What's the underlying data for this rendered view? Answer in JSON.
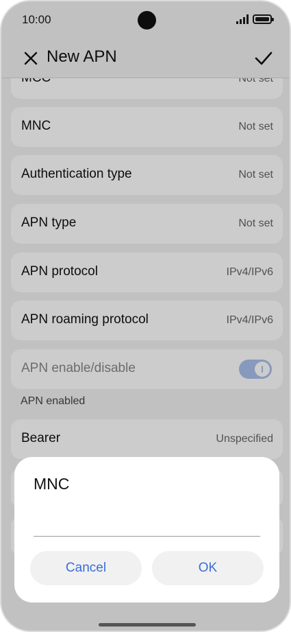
{
  "status_bar": {
    "time": "10:00"
  },
  "header": {
    "title": "New APN"
  },
  "list": {
    "rows": [
      {
        "label": "MCC",
        "value": "Not set"
      },
      {
        "label": "MNC",
        "value": "Not set"
      },
      {
        "label": "Authentication type",
        "value": "Not set"
      },
      {
        "label": "APN type",
        "value": "Not set"
      },
      {
        "label": "APN protocol",
        "value": "IPv4/IPv6"
      },
      {
        "label": "APN roaming protocol",
        "value": "IPv4/IPv6"
      }
    ],
    "enable_row": {
      "label": "APN enable/disable",
      "toggle_on": true
    },
    "enable_note": "APN enabled",
    "bearer_row": {
      "label": "Bearer",
      "value": "Unspecified"
    }
  },
  "dialog": {
    "title": "MNC",
    "input_value": "",
    "cancel_label": "Cancel",
    "ok_label": "OK"
  },
  "colors": {
    "accent": "#3a6dd8",
    "toggle": "#a9c0ec"
  }
}
